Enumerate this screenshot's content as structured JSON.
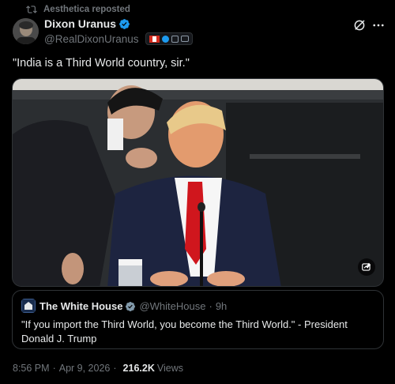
{
  "repost": {
    "text": "Aesthetica reposted",
    "icon": "repost-icon"
  },
  "author": {
    "name": "Dixon Uranus",
    "handle": "@RealDixonUranus",
    "verified": true,
    "verified_color": "#1d9bf0"
  },
  "header_icons": [
    "grok-icon",
    "more-icon"
  ],
  "tweet": {
    "text": "\"India is a Third World country, sir.\""
  },
  "media": {
    "description_icon": "image-edit-icon"
  },
  "quote": {
    "name": "The White House",
    "handle": "@WhiteHouse",
    "separator": "·",
    "time": "9h",
    "text": "\"If you import the Third World, you become the Third World.\" - President Donald J. Trump"
  },
  "footer": {
    "time": "8:56 PM",
    "date": "Apr 9, 2026",
    "separator": "·",
    "views_count": "216.2K",
    "views_label": "Views"
  },
  "colors": {
    "background": "#000000",
    "text": "#e7e9ea",
    "muted": "#71767b",
    "border": "#2f3336",
    "accent": "#1d9bf0"
  }
}
